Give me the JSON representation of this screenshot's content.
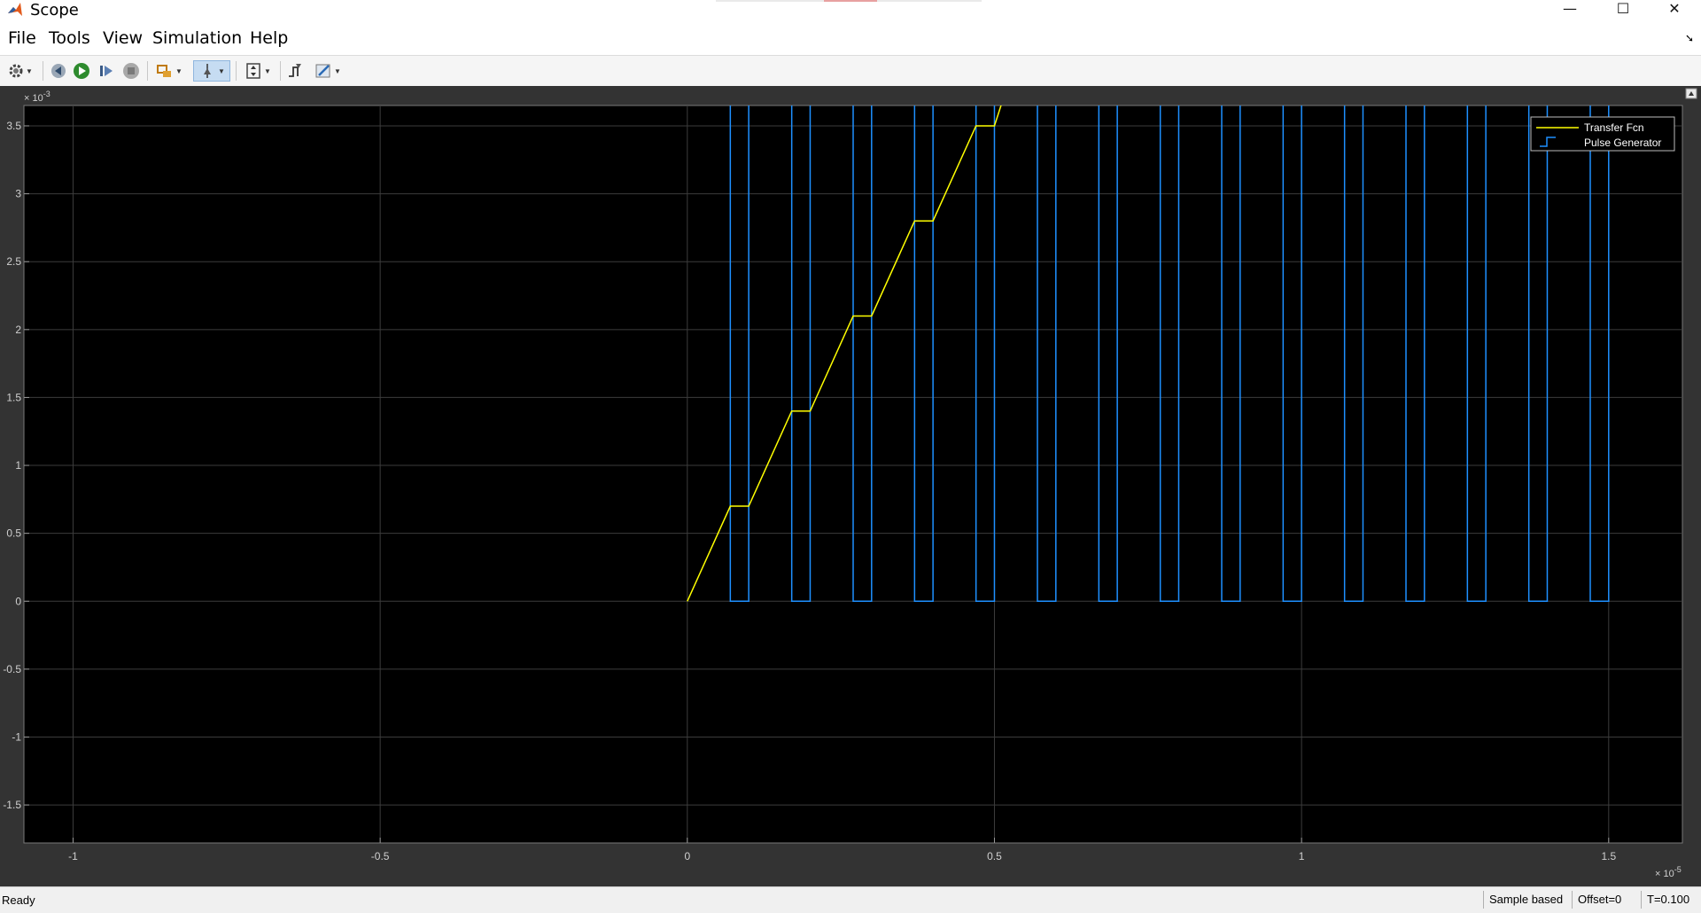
{
  "window": {
    "title": "Scope",
    "controls": [
      "—",
      "☐",
      "✕"
    ]
  },
  "menu": {
    "items": [
      "File",
      "Tools",
      "View",
      "Simulation",
      "Help"
    ]
  },
  "toolbar": {
    "icons": [
      "settings-icon",
      "step-back-icon",
      "run-icon",
      "step-forward-icon",
      "stop-icon",
      "highlight-icon",
      "zoom-mode-icon",
      "scale-axes-icon",
      "triggers-icon",
      "style-icon"
    ]
  },
  "chart_data": {
    "type": "line",
    "x_exponent_label": "× 10",
    "x_exponent": "-5",
    "y_exponent_label": "× 10",
    "y_exponent": "-3",
    "xlim": [
      -1.08,
      1.62
    ],
    "ylim": [
      -1.78,
      3.65
    ],
    "x_ticks": [
      -1,
      -0.5,
      0,
      0.5,
      1,
      1.5
    ],
    "x_tick_labels": [
      "-1",
      "-0.5",
      "0",
      "0.5",
      "1",
      "1.5"
    ],
    "y_ticks": [
      -1.5,
      -1,
      -0.5,
      0,
      0.5,
      1,
      1.5,
      2,
      2.5,
      3,
      3.5
    ],
    "y_tick_labels": [
      "-1.5",
      "-1",
      "-0.5",
      "0",
      "0.5",
      "1",
      "1.5",
      "2",
      "2.5",
      "3",
      "3.5"
    ],
    "grid": true,
    "legend_position": "top-right",
    "series": [
      {
        "name": "Transfer Fcn",
        "color": "#ffff00",
        "x": [
          0,
          0.07,
          0.1,
          0.17,
          0.2,
          0.27,
          0.3,
          0.37,
          0.4,
          0.47,
          0.5,
          0.525
        ],
        "y": [
          0,
          0.7,
          0.7,
          1.4,
          1.4,
          2.1,
          2.1,
          2.8,
          2.8,
          3.5,
          3.5,
          3.85
        ]
      },
      {
        "name": "Pulse Generator",
        "color": "#1e90ff",
        "type": "pulse",
        "period": 0.1,
        "start": 0.07,
        "low_duration": 0.03,
        "count": 15,
        "high": 3.7,
        "low": 0
      }
    ]
  },
  "axes_control": {
    "icon": "expand-axes-icon"
  },
  "status": {
    "ready": "Ready",
    "sample_mode": "Sample based",
    "offset": "Offset=0",
    "time": "T=0.100"
  }
}
